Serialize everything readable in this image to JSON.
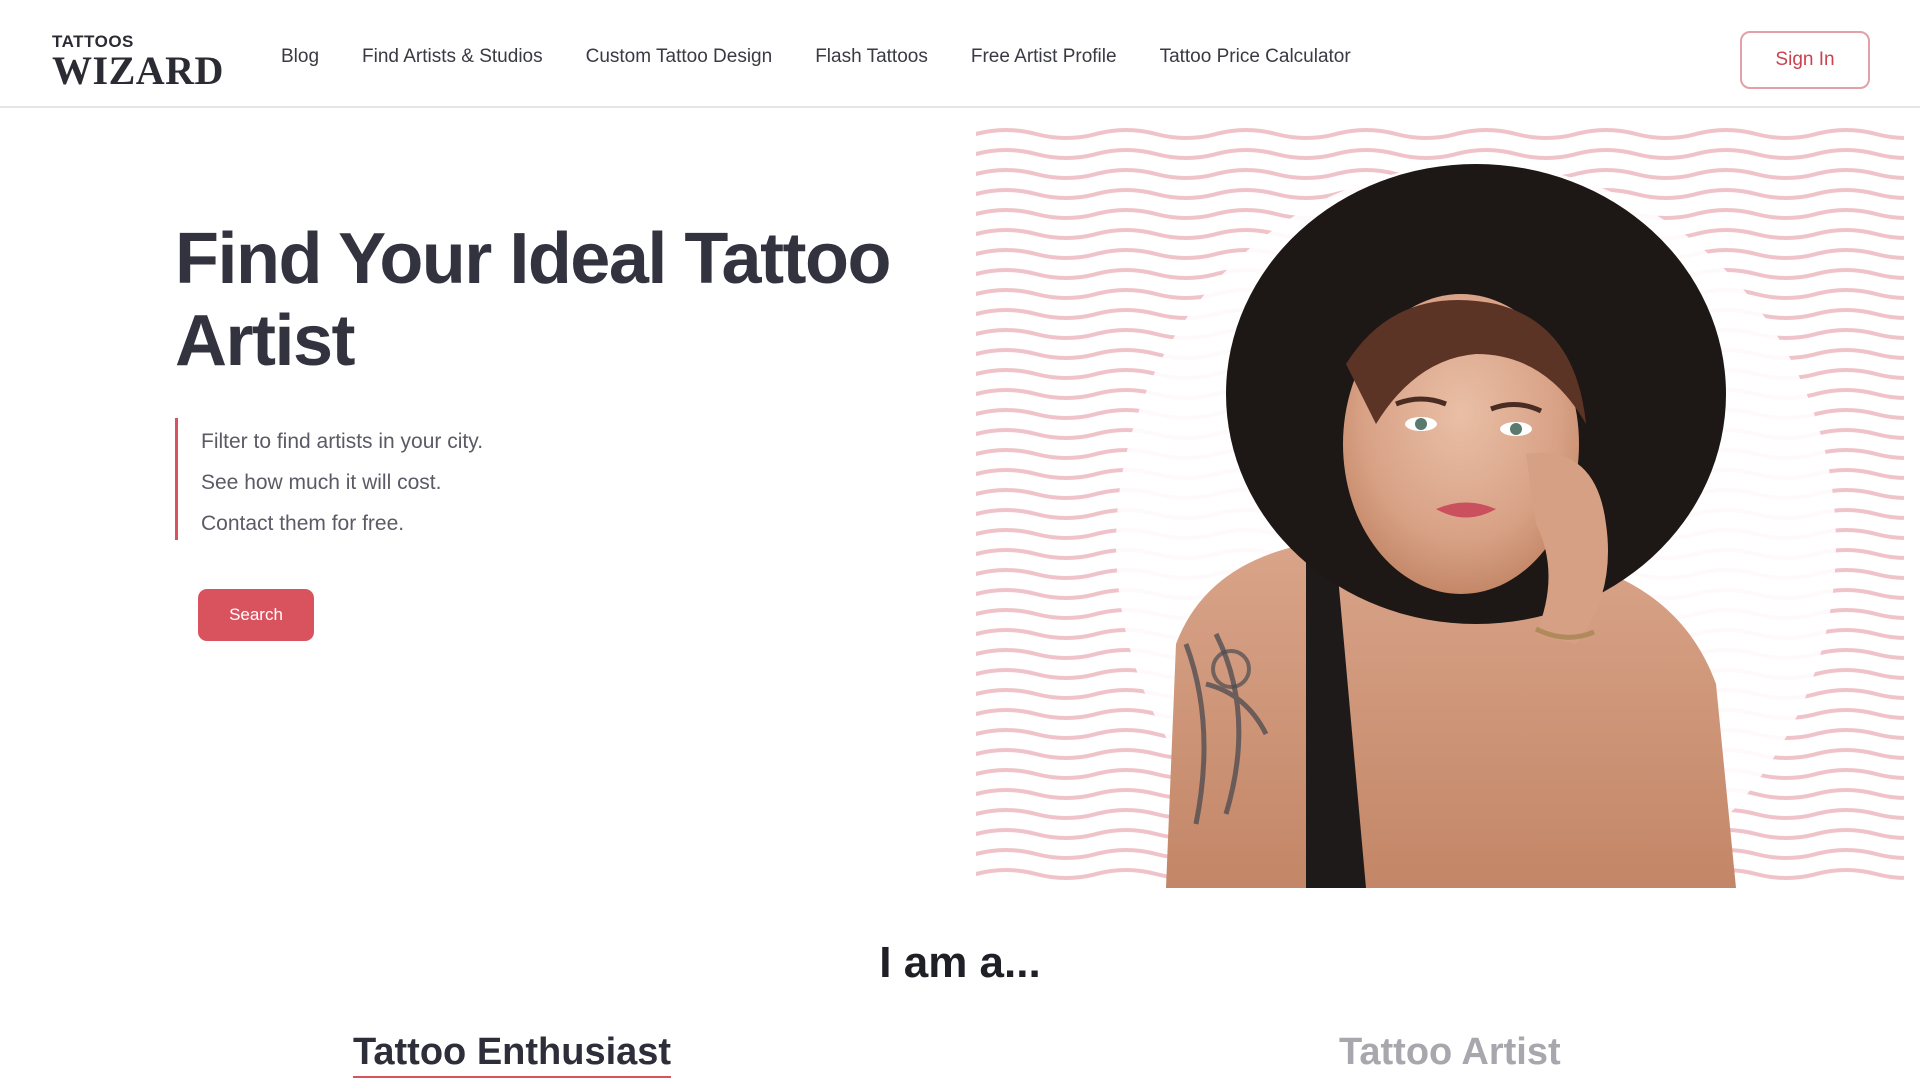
{
  "header": {
    "logo": {
      "top": "TATTOOS",
      "bottom": "WIZARD"
    },
    "nav": [
      {
        "label": "Blog"
      },
      {
        "label": "Find Artists & Studios"
      },
      {
        "label": "Custom Tattoo Design"
      },
      {
        "label": "Flash Tattoos"
      },
      {
        "label": "Free Artist Profile"
      },
      {
        "label": "Tattoo Price Calculator"
      }
    ],
    "signin_label": "Sign In"
  },
  "hero": {
    "title_line1": "Find Your Ideal Tattoo",
    "title_line2": "Artist",
    "lines": [
      "Filter to find artists in your city.",
      "See how much it will cost.",
      "Contact them for free."
    ],
    "search_label": "Search",
    "image_icon": "tattooed-model-photo"
  },
  "section": {
    "heading": "I am a...",
    "tabs": [
      {
        "label": "Tattoo Enthusiast",
        "active": true
      },
      {
        "label": "Tattoo Artist",
        "active": false
      }
    ]
  },
  "colors": {
    "accent": "#d9535f",
    "accent_light": "#e2a1a9",
    "text_dark": "#33333f",
    "text_muted": "#5b5b66",
    "inactive_tab": "#a7a7ad",
    "wave_pattern": "#efc3c9"
  }
}
